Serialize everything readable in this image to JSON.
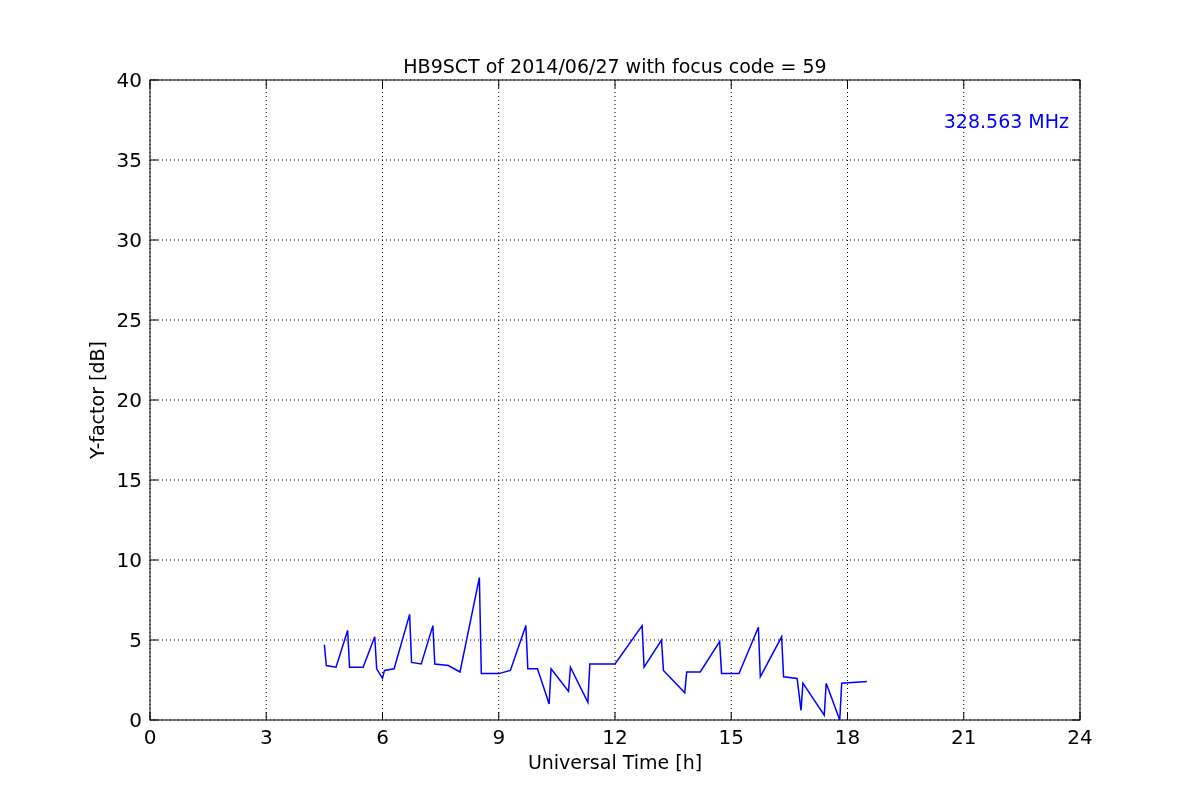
{
  "chart_data": {
    "type": "line",
    "title": "HB9SCT of 2014/06/27 with focus code = 59",
    "xlabel": "Universal Time [h]",
    "ylabel": "Y-factor [dB]",
    "x": [
      4.5,
      4.55,
      4.8,
      5.1,
      5.15,
      5.5,
      5.8,
      5.85,
      6.0,
      6.05,
      6.3,
      6.7,
      6.75,
      7.0,
      7.3,
      7.35,
      7.7,
      8.0,
      8.5,
      8.55,
      9.0,
      9.3,
      9.7,
      9.75,
      10.0,
      10.3,
      10.35,
      10.8,
      10.85,
      11.3,
      11.35,
      12.0,
      12.7,
      12.75,
      13.2,
      13.25,
      13.8,
      13.85,
      14.2,
      14.7,
      14.75,
      15.2,
      15.7,
      15.75,
      16.3,
      16.35,
      16.7,
      16.8,
      16.85,
      17.4,
      17.45,
      17.8,
      17.85,
      18.5
    ],
    "series": [
      {
        "color": "#0000ff",
        "values": [
          4.7,
          3.4,
          3.3,
          5.6,
          3.3,
          3.3,
          5.2,
          3.2,
          2.6,
          3.1,
          3.2,
          6.6,
          3.6,
          3.5,
          5.9,
          3.5,
          3.4,
          3.0,
          8.9,
          2.9,
          2.9,
          3.1,
          5.9,
          3.2,
          3.2,
          1.0,
          3.2,
          1.8,
          3.3,
          1.1,
          3.5,
          3.5,
          5.9,
          3.3,
          5.0,
          3.1,
          1.7,
          3.0,
          3.0,
          4.9,
          2.9,
          2.9,
          5.8,
          2.7,
          5.2,
          2.7,
          2.6,
          0.6,
          2.3,
          0.3,
          2.3,
          0.0,
          2.3,
          2.4
        ]
      }
    ],
    "xlim": [
      0,
      24
    ],
    "ylim": [
      0,
      40
    ],
    "xticks": [
      0,
      3,
      6,
      9,
      12,
      15,
      18,
      21,
      24
    ],
    "yticks": [
      0,
      5,
      10,
      15,
      20,
      25,
      30,
      35,
      40
    ],
    "grid": true,
    "annotations": [
      "328.563 MHz"
    ]
  }
}
